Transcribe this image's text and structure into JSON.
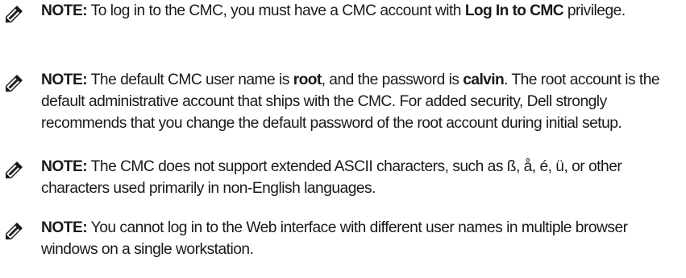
{
  "notes": [
    {
      "label": "NOTE:",
      "segments": [
        {
          "text": " To log in to the CMC, you must have a CMC account with ",
          "bold": false
        },
        {
          "text": "Log In to CMC",
          "bold": true
        },
        {
          "text": " privilege.",
          "bold": false
        }
      ]
    },
    {
      "label": "NOTE:",
      "segments": [
        {
          "text": " The default CMC user name is ",
          "bold": false
        },
        {
          "text": "root",
          "bold": true
        },
        {
          "text": ", and the password is ",
          "bold": false
        },
        {
          "text": "calvin",
          "bold": true
        },
        {
          "text": ". The root account is the default administrative account that ships with the CMC. For added security, Dell strongly recommends that you change the default password of the root account during initial setup.",
          "bold": false
        }
      ]
    },
    {
      "label": "NOTE:",
      "segments": [
        {
          "text": " The CMC does not support extended ASCII characters, such as ß, å, é, ü, or other characters used primarily in non-English languages.",
          "bold": false
        }
      ]
    },
    {
      "label": "NOTE:",
      "segments": [
        {
          "text": " You cannot log in to the Web interface with different user names in multiple browser windows on a single workstation.",
          "bold": false
        }
      ]
    }
  ],
  "icons": {
    "note_icon": "pencil-icon",
    "color": "#1a1a1a"
  }
}
